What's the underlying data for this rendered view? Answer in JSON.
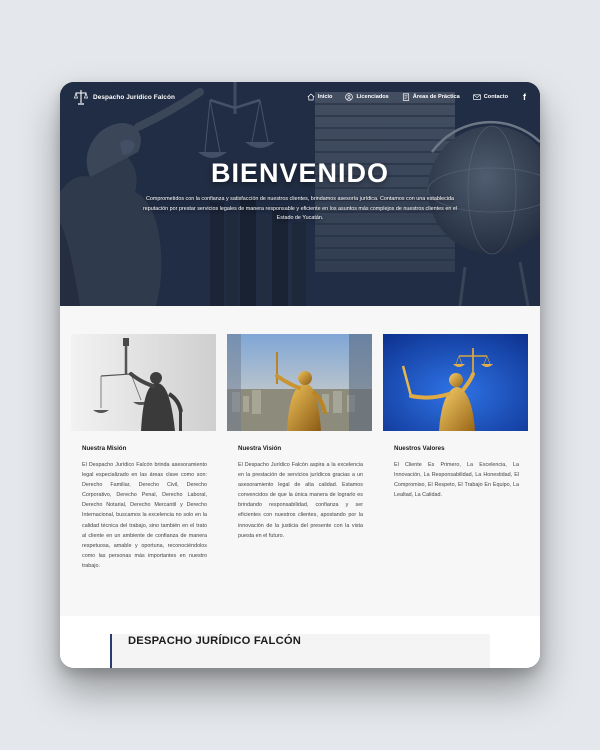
{
  "brand": {
    "name": "Despacho Jurídico Falcón",
    "logo_icon": "scales-of-justice-icon"
  },
  "nav": {
    "items": [
      {
        "label": "Inicio",
        "icon": "home-icon"
      },
      {
        "label": "Licenciados",
        "icon": "user-circle-icon"
      },
      {
        "label": "Áreas de Práctica",
        "icon": "document-icon"
      },
      {
        "label": "Contacto",
        "icon": "envelope-icon"
      }
    ],
    "social": {
      "label": "f",
      "icon": "facebook-icon"
    }
  },
  "hero": {
    "title": "BIENVENIDO",
    "text": "Comprometidos con la confianza y satisfacción de nuestros clientes, brindamos asesoría jurídica. Contamos con una establecida reputación por prestar servicios legales de manera responsable y eficiente en los asuntos más complejos de nuestros clientes en el Estado de Yucatán."
  },
  "cards": [
    {
      "title": "Nuestra Misión",
      "body": "El Despacho Jurídico Falcón brinda asesoramiento legal especializado en las áreas clave como son: Derecho Familiar, Derecho Civil, Derecho Corporativo, Derecho Penal, Derecho Laboral, Derecho Notarial, Derecho Mercantil y Derecho Internacional, buscamos la excelencia no solo en la calidad técnica del trabajo, sino también en el trato al cliente en un ambiente de confianza de manera respetuosa, amable y oportuna, reconociéndolos como las personas más importantes en nuestro trabajo."
    },
    {
      "title": "Nuestra Visión",
      "body": "El Despacho Jurídico Falcón aspira a la excelencia en la prestación de servicios jurídicos gracias a un asesoramiento legal de alta calidad. Estamos convencidos de que la única manera de lograrlo es brindando responsabilidad, confianza y ser eficientes con nuestros clientes, apostando por la innovación de la justicia del presente con la vista puesta en el futuro."
    },
    {
      "title": "Nuestros Valores",
      "body": "El Cliente Es Primero, La Excelencia, La Innovación, La Responsabilidad, La Honestidad, El Compromiso, El Respeto, El Trabajo En Equipo, La Lealtad, La Calidad."
    }
  ],
  "footer_section": {
    "title": "DESPACHO JURÍDICO FALCÓN"
  },
  "colors": {
    "hero_dark": "#1d2a3d",
    "accent_navy": "#2a3b6f",
    "gold": "#c9962f",
    "sky_blue": "#1a4fc4"
  }
}
